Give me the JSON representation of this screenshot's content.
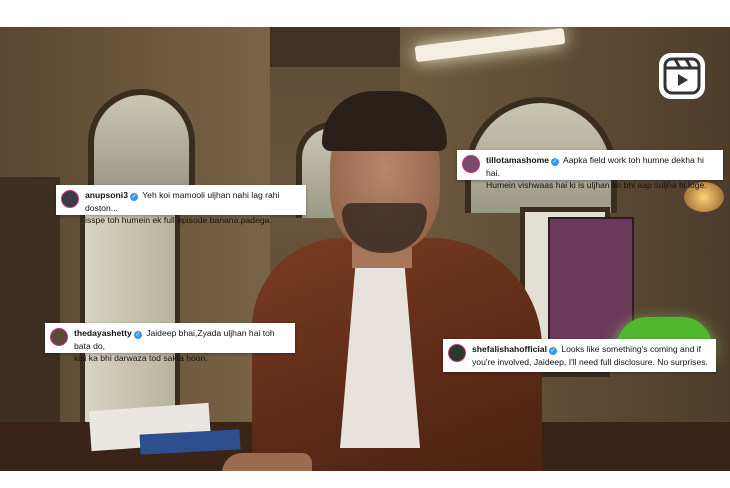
{
  "comments": [
    {
      "username": "tillotamashome",
      "line1": "Aapka field work toh humne dekha hi hai.",
      "line2": "Humein vishwaas hai ki is uljhan ko bhi aap suljha hi loge.",
      "avatar_color": "#7a4a6a"
    },
    {
      "username": "anupsoni3",
      "line1": "Yeh koi mamooli uljhan nahi lag rahi doston...",
      "line2": "isspe toh humein ek full episode banana padega.",
      "avatar_color": "#3a3a4a"
    },
    {
      "username": "thedayashetty",
      "line1": "Jaideep bhai,Zyada uljhan hai toh bata do,",
      "line2": "kisi ka bhi darwaza tod sakta hoon.",
      "avatar_color": "#5a4a3a"
    },
    {
      "username": "shefalishahofficial",
      "line1": "Looks like something's coming and if",
      "line2": "you're involved, Jaideep, I'll need full disclosure. No surprises.",
      "avatar_color": "#2a3a2a"
    }
  ],
  "icons": {
    "reels": "instagram-reels-icon",
    "verified": "verified-badge-icon"
  },
  "colors": {
    "verified": "#3897f0",
    "jacket": "#7a3c22",
    "lamp": "#4fb830"
  }
}
